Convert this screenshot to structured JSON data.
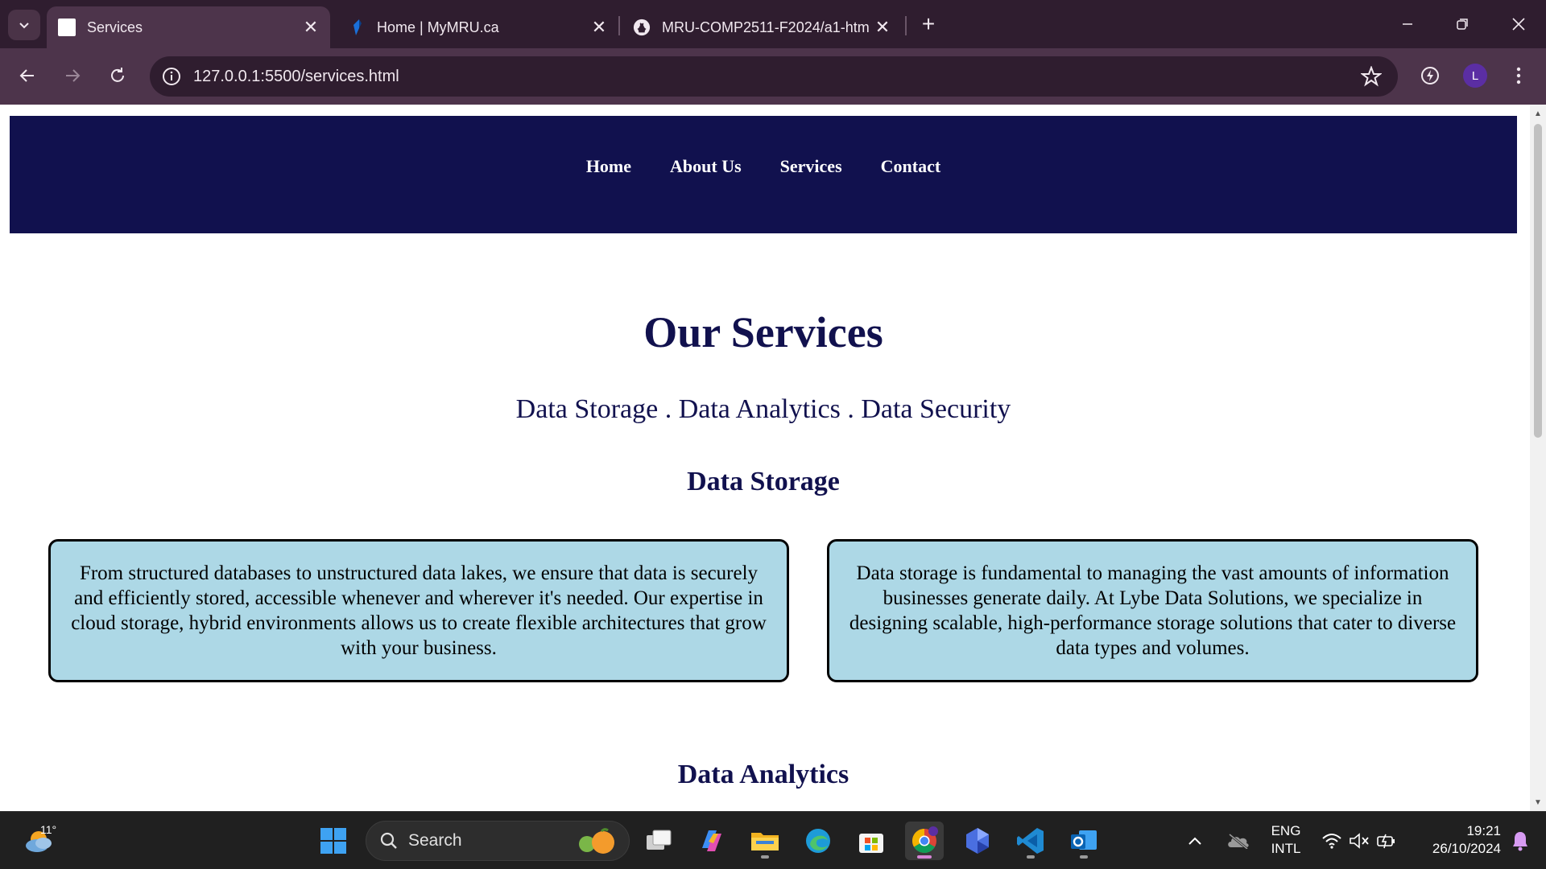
{
  "browser": {
    "tabs": [
      {
        "title": "Services",
        "active": true
      },
      {
        "title": "Home | MyMRU.ca",
        "active": false
      },
      {
        "title": "MRU-COMP2511-F2024/a1-htm",
        "active": false
      }
    ],
    "url": "127.0.0.1:5500/services.html",
    "profile_initial": "L"
  },
  "site": {
    "nav": [
      "Home",
      "About Us",
      "Services",
      "Contact"
    ],
    "heading": "Our Services",
    "subheading": "Data Storage . Data Analytics . Data Security",
    "sections": [
      {
        "title": "Data Storage",
        "cards": [
          "From structured databases to unstructured data lakes, we ensure that data is securely and efficiently stored, accessible whenever and wherever it's needed. Our expertise in cloud storage, hybrid environments allows us to create flexible architectures that grow with your business.",
          "Data storage is fundamental to managing the vast amounts of information businesses generate daily. At Lybe Data Solutions, we specialize in designing scalable, high-performance storage solutions that cater to diverse data types and volumes."
        ]
      },
      {
        "title": "Data Analytics"
      }
    ]
  },
  "taskbar": {
    "weather_temp": "11°",
    "search_label": "Search",
    "language": "ENG",
    "layout": "INTL",
    "time": "19:21",
    "date": "26/10/2024"
  },
  "colors": {
    "nav_bg": "#11114e",
    "card_bg": "#add8e6",
    "heading": "#11114e"
  }
}
